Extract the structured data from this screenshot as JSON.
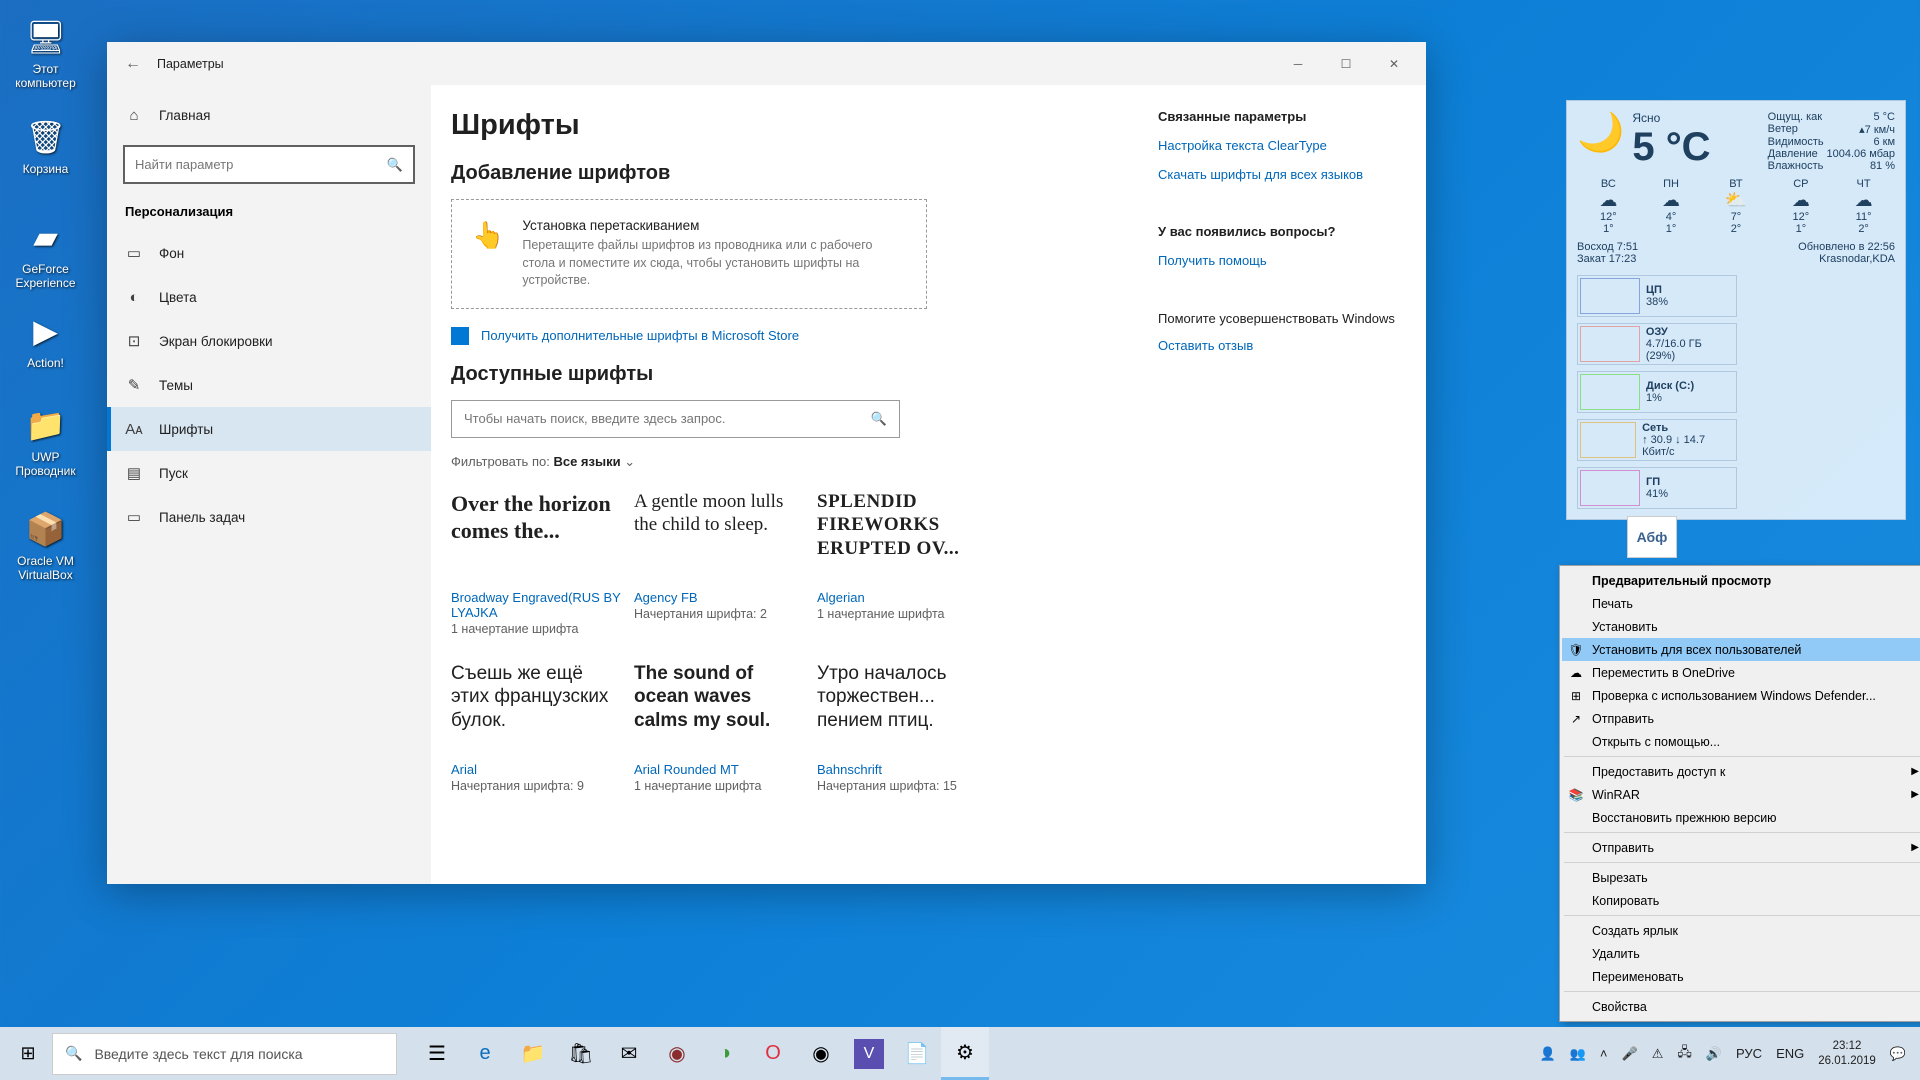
{
  "desktop_icons": [
    "Этот компьютер",
    "Корзина",
    "GeForce Experience",
    "Action!",
    "UWP Проводник",
    "Oracle VM VirtualBox"
  ],
  "window": {
    "title": "Параметры",
    "search_placeholder": "Найти параметр",
    "section": "Персонализация",
    "nav": [
      {
        "icon": "⌂",
        "label": "Главная"
      },
      {
        "icon": "▭",
        "label": "Фон"
      },
      {
        "icon": "◐",
        "label": "Цвета"
      },
      {
        "icon": "⊡",
        "label": "Экран блокировки"
      },
      {
        "icon": "✎",
        "label": "Темы"
      },
      {
        "icon": "Aᴀ",
        "label": "Шрифты",
        "selected": true
      },
      {
        "icon": "▤",
        "label": "Пуск"
      },
      {
        "icon": "▭",
        "label": "Панель задач"
      }
    ],
    "h1": "Шрифты",
    "add_heading": "Добавление шрифтов",
    "drop": {
      "title": "Установка перетаскиванием",
      "body": "Перетащите файлы шрифтов из проводника или с рабочего стола и поместите их сюда, чтобы установить шрифты на устройстве."
    },
    "store_link": "Получить дополнительные шрифты в Microsoft Store",
    "avail_heading": "Доступные шрифты",
    "font_search_placeholder": "Чтобы начать поиск, введите здесь запрос.",
    "filter_label": "Фильтровать по:",
    "filter_value": "Все языки",
    "fonts": [
      {
        "preview": "Over the horizon comes the...",
        "name": "Broadway Engraved(RUS BY LYAJKA",
        "meta": "1 начертание шрифта",
        "style": "font-family:'Stencil',serif; font-weight:700; font-size:22px;"
      },
      {
        "preview": "A gentle moon lulls the child to sleep.",
        "name": "Agency FB",
        "meta": "Начертания шрифта: 2",
        "style": "font-family:Arial Narrow; font-size:19px;"
      },
      {
        "preview": "SPLENDID FIREWORKS ERUPTED OV...",
        "name": "Algerian",
        "meta": "1 начертание шрифта",
        "style": "font-family:serif; font-weight:700; font-size:19px; letter-spacing:0.5px; font-variant:small-caps;"
      },
      {
        "preview": "Съешь же ещё этих французских булок.",
        "name": "Arial",
        "meta": "Начертания шрифта: 9",
        "style": "font-family:Arial; font-size:19px;"
      },
      {
        "preview": "The sound of ocean waves calms my soul.",
        "name": "Arial Rounded MT",
        "meta": "1 начертание шрифта",
        "style": "font-family:Arial; font-weight:700; font-size:19px;"
      },
      {
        "preview": "Утро началось торжествен... пением птиц.",
        "name": "Bahnschrift",
        "meta": "Начертания шрифта: 15",
        "style": "font-family:Arial; font-size:19px;"
      }
    ],
    "right": {
      "related_h": "Связанные параметры",
      "cleartype": "Настройка текста ClearType",
      "download": "Скачать шрифты для всех языков",
      "questions_h": "У вас появились вопросы?",
      "help": "Получить помощь",
      "improve_h": "Помогите усовершенствовать Windows",
      "feedback": "Оставить отзыв"
    }
  },
  "widget": {
    "cond": "Ясно",
    "temp": "5 °C",
    "feels_l": "Ощущ. как",
    "feels": "5 °C",
    "wind_l": "Ветер",
    "wind": "▴7 км/ч",
    "vis_l": "Видимость",
    "vis": "6 км",
    "press_l": "Давление",
    "press": "1004.06 мбар",
    "hum_l": "Влажность",
    "hum": "81 %",
    "days": [
      "ВС",
      "ПН",
      "ВТ",
      "СР",
      "ЧТ"
    ],
    "highs": [
      "12°",
      "4°",
      "7°",
      "12°",
      "11°"
    ],
    "lows": [
      "1°",
      "1°",
      "2°",
      "1°",
      "2°"
    ],
    "sunrise_l": "Восход",
    "sunrise": "7:51",
    "sunset_l": "Закат",
    "sunset": "17:23",
    "updated": "Обновлено в 22:56",
    "loc": "Krasnodar,KDA",
    "stats": [
      {
        "name": "ЦП",
        "val": "38%"
      },
      {
        "name": "ОЗУ",
        "val": "4.7/16.0 ГБ (29%)"
      },
      {
        "name": "Диск (C:)",
        "val": "1%"
      },
      {
        "name": "Сеть",
        "val": "↑ 30.9 ↓ 14.7 Кбит/с"
      },
      {
        "name": "ГП",
        "val": "41%"
      }
    ]
  },
  "font_file_label": "Абф",
  "context_menu": [
    {
      "label": "Предварительный просмотр",
      "bold": true
    },
    {
      "label": "Печать"
    },
    {
      "label": "Установить"
    },
    {
      "label": "Установить для всех пользователей",
      "icon": "🛡",
      "hover": true
    },
    {
      "label": "Переместить в OneDrive",
      "icon": "☁"
    },
    {
      "label": "Проверка с использованием Windows Defender...",
      "icon": "⊞"
    },
    {
      "label": "Отправить",
      "icon": "↗"
    },
    {
      "label": "Открыть с помощью..."
    },
    {
      "sep": true
    },
    {
      "label": "Предоставить доступ к",
      "arrow": true
    },
    {
      "label": "WinRAR",
      "icon": "📚",
      "arrow": true
    },
    {
      "label": "Восстановить прежнюю версию"
    },
    {
      "sep": true
    },
    {
      "label": "Отправить",
      "arrow": true
    },
    {
      "sep": true
    },
    {
      "label": "Вырезать"
    },
    {
      "label": "Копировать"
    },
    {
      "sep": true
    },
    {
      "label": "Создать ярлык"
    },
    {
      "label": "Удалить"
    },
    {
      "label": "Переименовать"
    },
    {
      "sep": true
    },
    {
      "label": "Свойства"
    }
  ],
  "taskbar": {
    "search_placeholder": "Введите здесь текст для поиска",
    "lang": "РУС",
    "kb": "ENG",
    "time": "23:12",
    "date": "26.01.2019"
  }
}
